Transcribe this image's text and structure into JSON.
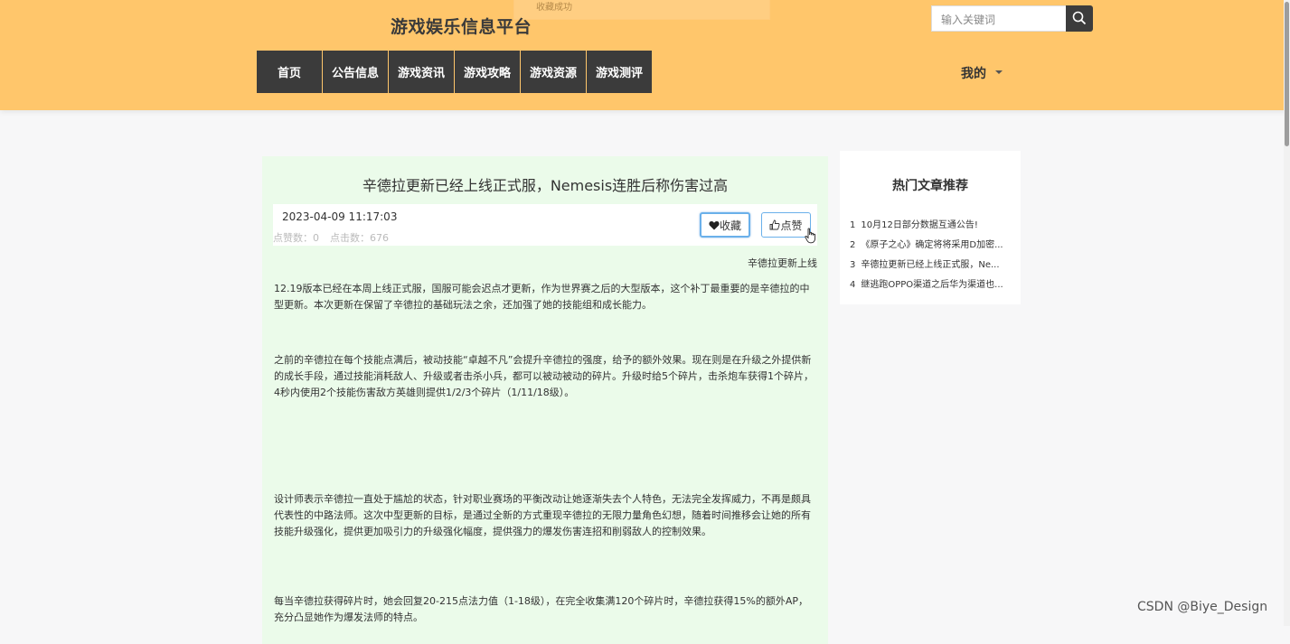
{
  "header": {
    "site_title": "游戏娱乐信息平台",
    "toast": "收藏成功",
    "search": {
      "placeholder": "输入关键词"
    },
    "nav": [
      "首页",
      "公告信息",
      "游戏资讯",
      "游戏攻略",
      "游戏资源",
      "游戏测评"
    ],
    "user_menu": "我的"
  },
  "article": {
    "title": "辛德拉更新已经上线正式服，Nemesis连胜后称伤害过高",
    "date": "2023-04-09 11:17:03",
    "likes": "点赞数：0",
    "clicks": "点击数：676",
    "fav_label": "收藏",
    "like_label": "点赞",
    "subtitle": "辛德拉更新上线",
    "paragraphs": [
      "12.19版本已经在本周上线正式服，国服可能会迟点才更新，作为世界赛之后的大型版本，这个补丁最重要的是辛德拉的中型更新。本次更新在保留了辛德拉的基础玩法之余，还加强了她的技能组和成长能力。",
      "之前的辛德拉在每个技能点满后，被动技能“卓越不凡”会提升辛德拉的强度，给予的额外效果。现在则是在升级之外提供新的成长手段，通过技能消耗敌人、升级或者击杀小兵，都可以被动被动的碎片。升级时给5个碎片，击杀炮车获得1个碎片，4秒内使用2个技能伤害敌方英雄则提供1/2/3个碎片（1/11/18级）。",
      "设计师表示辛德拉一直处于尴尬的状态，针对职业赛场的平衡改动让她逐渐失去个人特色，无法完全发挥威力，不再是颇具代表性的中路法师。这次中型更新的目标，是通过全新的方式重现辛德拉的无限力量角色幻想，随着时间推移会让她的所有技能升级强化，提供更加吸引力的升级强化幅度，提供强力的爆发伤害连招和削弱敌人的控制效果。",
      "每当辛德拉获得碎片时，她会回复20-215点法力值（1-18级），在完全收集满120个碎片时，辛德拉获得15%的额外AP，充分凸显她作为爆发法师的特点。"
    ]
  },
  "sidebar": {
    "title": "热门文章推荐",
    "items": [
      {
        "num": "1",
        "text": "10月12日部分数据互通公告!"
      },
      {
        "num": "2",
        "text": "《原子之心》确定将将采用D加密..."
      },
      {
        "num": "3",
        "text": "辛德拉更新已经上线正式服，Ne..."
      },
      {
        "num": "4",
        "text": "继逃跑OPPO渠道之后华为渠道也..."
      }
    ]
  },
  "watermark": "CSDN @Biye_Design",
  "colors": {
    "header_bg": "#ffc66b",
    "nav_bg": "#3b3b3b",
    "article_bg": "#ebfbea",
    "button_border": "#6ab0ea"
  },
  "icons": [
    "search-icon",
    "heart-icon",
    "thumbs-up-icon",
    "caret-down-icon",
    "hand-cursor-icon"
  ]
}
